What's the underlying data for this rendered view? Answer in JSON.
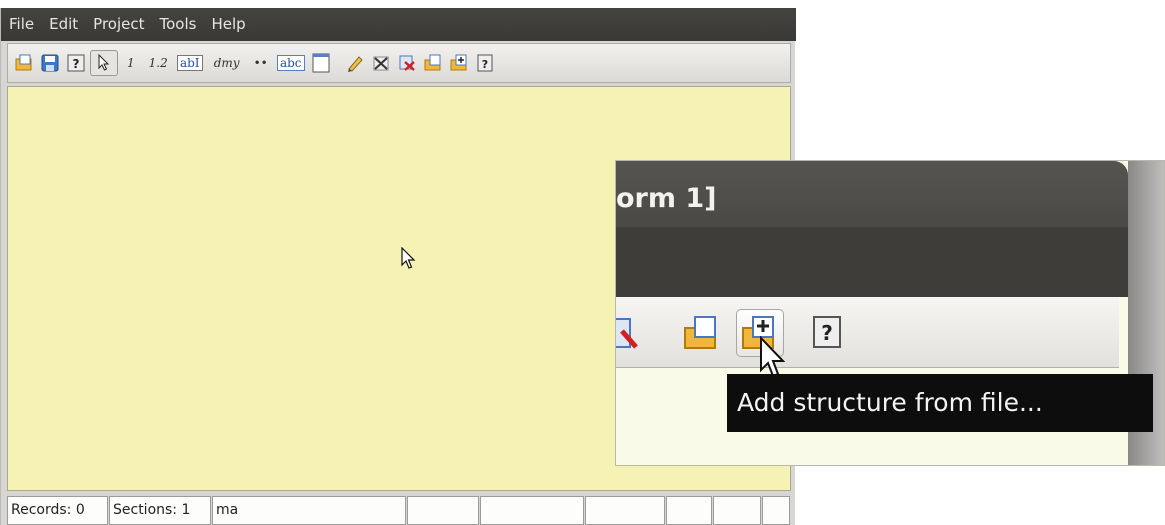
{
  "menubar": {
    "items": [
      "File",
      "Edit",
      "Project",
      "Tools",
      "Help"
    ]
  },
  "toolbar": {
    "integer_label": "1",
    "decimal_label": "1.2",
    "text_field_label": "abI",
    "date_label": "dmy",
    "dots_label": "••",
    "abc_label": "abc"
  },
  "statusbar": {
    "records": "Records: 0",
    "sections": "Sections: 1",
    "field": "ma"
  },
  "inset": {
    "title_fragment": "orm 1]",
    "tooltip": "Add structure from file..."
  },
  "colors": {
    "canvas": "#f5f2b4",
    "menubar": "#3f3e3a",
    "tooltip_bg": "#0d0d0d"
  }
}
